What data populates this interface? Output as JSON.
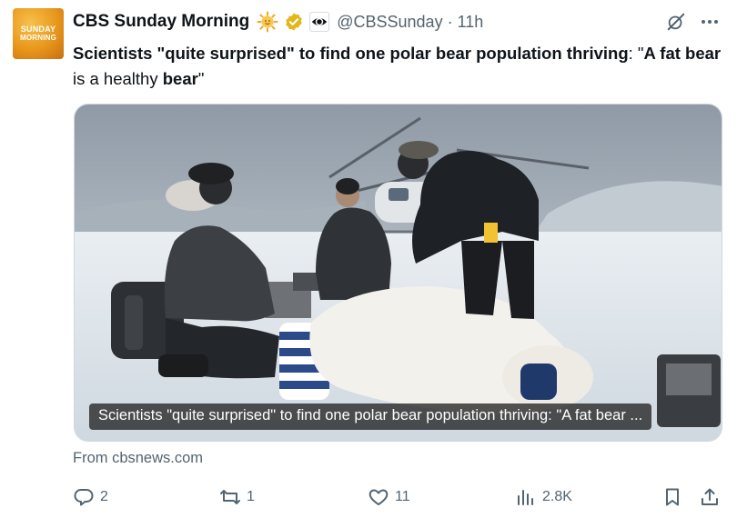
{
  "account": {
    "display_name": "CBS Sunday Morning",
    "handle": "@CBSSunday",
    "separator": "·",
    "time": "11h",
    "avatar_text_line1": "SUNDAY",
    "avatar_text_line2": "MORNING",
    "avatar_color": "#e8961c"
  },
  "tweet": {
    "segments": [
      {
        "text": "Scientists \"quite surprised\" to find one polar bear population thriving",
        "bold": true
      },
      {
        "text": ": \"",
        "bold": false
      },
      {
        "text": "A fat bear",
        "bold": true
      },
      {
        "text": " is a healthy ",
        "bold": false
      },
      {
        "text": "bear",
        "bold": true
      },
      {
        "text": "\"",
        "bold": false
      }
    ]
  },
  "media": {
    "caption": "Scientists \"quite surprised\" to find one polar bear population thriving: \"A fat bear ...",
    "source": "From cbsnews.com"
  },
  "actions": {
    "reply_count": "2",
    "retweet_count": "1",
    "like_count": "11",
    "view_count": "2.8K"
  },
  "icons": {
    "badge": "sun-emoji-icon",
    "verified": "gold-verified-icon",
    "affiliate": "cbs-eye-icon",
    "grok": "grok-slash-icon",
    "more": "more-dots-icon",
    "reply": "reply-bubble-icon",
    "retweet": "retweet-icon",
    "like": "heart-icon",
    "views": "views-bars-icon",
    "bookmark": "bookmark-icon",
    "share": "share-icon"
  },
  "colors": {
    "text_primary": "#0f1419",
    "text_secondary": "#536471",
    "verified_gold": "#e2b719"
  }
}
